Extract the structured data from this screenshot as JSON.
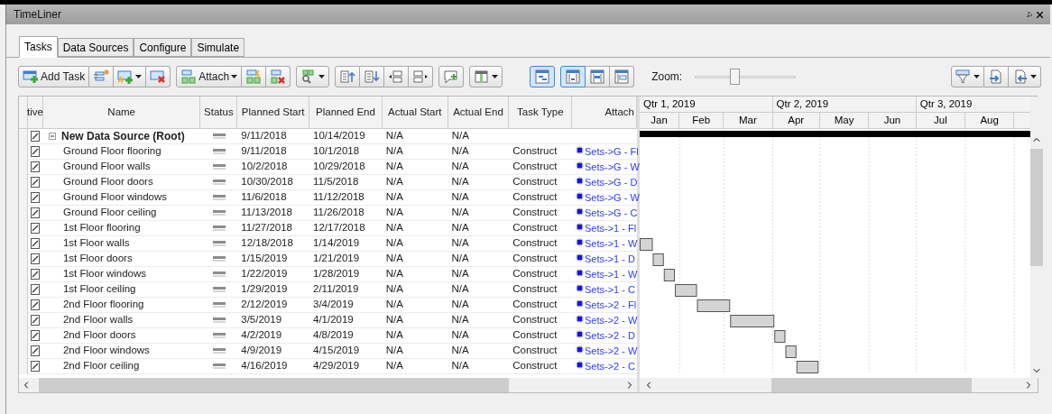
{
  "window": {
    "title": "TimeLiner"
  },
  "tabs": [
    {
      "label": "Tasks",
      "selected": true
    },
    {
      "label": "Data Sources",
      "selected": false
    },
    {
      "label": "Configure",
      "selected": false
    },
    {
      "label": "Simulate",
      "selected": false
    }
  ],
  "toolbar": {
    "groups": [
      [
        {
          "kind": "add-task",
          "label": "Add Task",
          "dropdown": false
        },
        {
          "kind": "auto-add",
          "dropdown": false
        },
        {
          "kind": "add-rule",
          "dropdown": true
        },
        {
          "kind": "delete",
          "dropdown": false
        }
      ],
      [
        {
          "kind": "attach",
          "label": "Attach",
          "dropdown": true
        },
        {
          "kind": "auto-attach",
          "dropdown": false
        },
        {
          "kind": "detach",
          "dropdown": false
        }
      ],
      [
        {
          "kind": "find",
          "dropdown": true
        }
      ],
      [
        {
          "kind": "move-up",
          "dropdown": false
        },
        {
          "kind": "move-down",
          "dropdown": false
        },
        {
          "kind": "outdent",
          "dropdown": false
        },
        {
          "kind": "indent",
          "dropdown": false
        }
      ],
      [
        {
          "kind": "comment",
          "dropdown": false
        }
      ],
      [
        {
          "kind": "columns",
          "dropdown": true
        }
      ]
    ],
    "views": [
      [
        {
          "kind": "gantt-only",
          "selected": true
        }
      ],
      [
        {
          "kind": "grid-gantt",
          "selected": true
        },
        {
          "kind": "grid-bar",
          "selected": false
        },
        {
          "kind": "grid-split",
          "selected": false
        }
      ]
    ],
    "zoom": {
      "label": "Zoom:",
      "level": 0.38
    },
    "right": [
      {
        "kind": "filter",
        "dropdown": true
      },
      {
        "kind": "export",
        "dropdown": false
      },
      {
        "kind": "import",
        "dropdown": true
      }
    ]
  },
  "table": {
    "columns": [
      "tive",
      "Name",
      "Status",
      "Planned Start",
      "Planned End",
      "Actual Start",
      "Actual End",
      "Task Type",
      "Attach"
    ],
    "tasks": [
      {
        "active": true,
        "name": "New Data Source (Root)",
        "expanded": true,
        "planned_start": "9/11/2018",
        "planned_end": "10/14/2019",
        "actual_start": "N/A",
        "actual_end": "N/A",
        "children": [
          {
            "active": true,
            "name": "Ground Floor flooring",
            "planned_start": "9/11/2018",
            "planned_end": "10/1/2018",
            "actual_start": "N/A",
            "actual_end": "N/A",
            "task_type": "Construct",
            "attached": "Sets->G - Fl"
          },
          {
            "active": true,
            "name": "Ground Floor walls",
            "planned_start": "10/2/2018",
            "planned_end": "10/29/2018",
            "actual_start": "N/A",
            "actual_end": "N/A",
            "task_type": "Construct",
            "attached": "Sets->G - W"
          },
          {
            "active": true,
            "name": "Ground Floor doors",
            "planned_start": "10/30/2018",
            "planned_end": "11/5/2018",
            "actual_start": "N/A",
            "actual_end": "N/A",
            "task_type": "Construct",
            "attached": "Sets->G - D"
          },
          {
            "active": true,
            "name": "Ground Floor windows",
            "planned_start": "11/6/2018",
            "planned_end": "11/12/2018",
            "actual_start": "N/A",
            "actual_end": "N/A",
            "task_type": "Construct",
            "attached": "Sets->G - W"
          },
          {
            "active": true,
            "name": "Ground Floor ceiling",
            "planned_start": "11/13/2018",
            "planned_end": "11/26/2018",
            "actual_start": "N/A",
            "actual_end": "N/A",
            "task_type": "Construct",
            "attached": "Sets->G - C"
          },
          {
            "active": true,
            "name": "1st Floor flooring",
            "planned_start": "11/27/2018",
            "planned_end": "12/17/2018",
            "actual_start": "N/A",
            "actual_end": "N/A",
            "task_type": "Construct",
            "attached": "Sets->1 - Fl"
          },
          {
            "active": true,
            "name": "1st Floor walls",
            "planned_start": "12/18/2018",
            "planned_end": "1/14/2019",
            "actual_start": "N/A",
            "actual_end": "N/A",
            "task_type": "Construct",
            "attached": "Sets->1 - W"
          },
          {
            "active": true,
            "name": "1st Floor doors",
            "planned_start": "1/15/2019",
            "planned_end": "1/21/2019",
            "actual_start": "N/A",
            "actual_end": "N/A",
            "task_type": "Construct",
            "attached": "Sets->1 - D"
          },
          {
            "active": true,
            "name": "1st Floor windows",
            "planned_start": "1/22/2019",
            "planned_end": "1/28/2019",
            "actual_start": "N/A",
            "actual_end": "N/A",
            "task_type": "Construct",
            "attached": "Sets->1 - W"
          },
          {
            "active": true,
            "name": "1st Floor ceiling",
            "planned_start": "1/29/2019",
            "planned_end": "2/11/2019",
            "actual_start": "N/A",
            "actual_end": "N/A",
            "task_type": "Construct",
            "attached": "Sets->1 - C"
          },
          {
            "active": true,
            "name": "2nd Floor flooring",
            "planned_start": "2/12/2019",
            "planned_end": "3/4/2019",
            "actual_start": "N/A",
            "actual_end": "N/A",
            "task_type": "Construct",
            "attached": "Sets->2 - Fl"
          },
          {
            "active": true,
            "name": "2nd Floor walls",
            "planned_start": "3/5/2019",
            "planned_end": "4/1/2019",
            "actual_start": "N/A",
            "actual_end": "N/A",
            "task_type": "Construct",
            "attached": "Sets->2 - W"
          },
          {
            "active": true,
            "name": "2nd Floor doors",
            "planned_start": "4/2/2019",
            "planned_end": "4/8/2019",
            "actual_start": "N/A",
            "actual_end": "N/A",
            "task_type": "Construct",
            "attached": "Sets->2 - D"
          },
          {
            "active": true,
            "name": "2nd Floor windows",
            "planned_start": "4/9/2019",
            "planned_end": "4/15/2019",
            "actual_start": "N/A",
            "actual_end": "N/A",
            "task_type": "Construct",
            "attached": "Sets->2 - W"
          },
          {
            "active": true,
            "name": "2nd Floor ceiling",
            "planned_start": "4/16/2019",
            "planned_end": "4/29/2019",
            "actual_start": "N/A",
            "actual_end": "N/A",
            "task_type": "Construct",
            "attached": "Sets->2 - C"
          }
        ]
      }
    ]
  },
  "timeline": {
    "quarters": [
      "Qtr 1, 2019",
      "Qtr 2, 2019",
      "Qtr 3, 2019"
    ],
    "months": [
      "Jan",
      "Feb",
      "Mar",
      "Apr",
      "May",
      "Jun",
      "Jul",
      "Aug"
    ]
  }
}
